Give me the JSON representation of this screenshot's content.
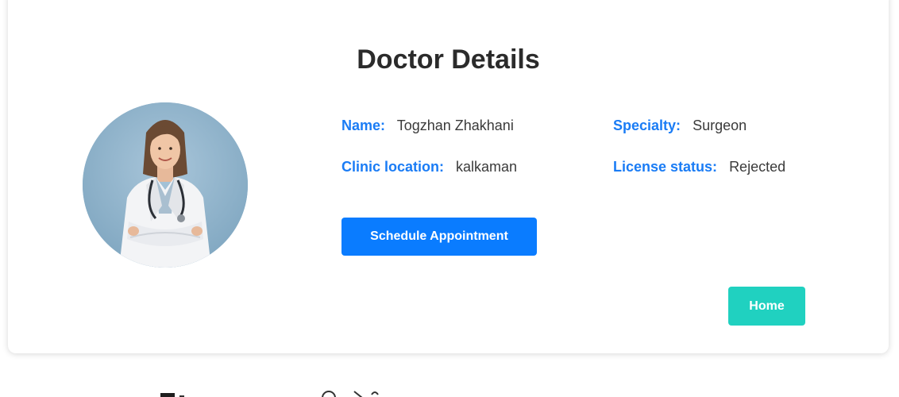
{
  "page": {
    "title": "Doctor Details"
  },
  "doctor": {
    "fields": [
      {
        "label": "Name:",
        "value": "Togzhan Zhakhani"
      },
      {
        "label": "Specialty:",
        "value": "Surgeon"
      },
      {
        "label": "Clinic location:",
        "value": "kalkaman"
      },
      {
        "label": "License status:",
        "value": "Rejected"
      }
    ],
    "photo_icon": "doctor-portrait"
  },
  "actions": {
    "schedule_label": "Schedule Appointment",
    "home_label": "Home"
  },
  "colors": {
    "label_blue": "#1a7cf5",
    "primary_button": "#0a7cff",
    "home_button": "#20d1c0"
  }
}
